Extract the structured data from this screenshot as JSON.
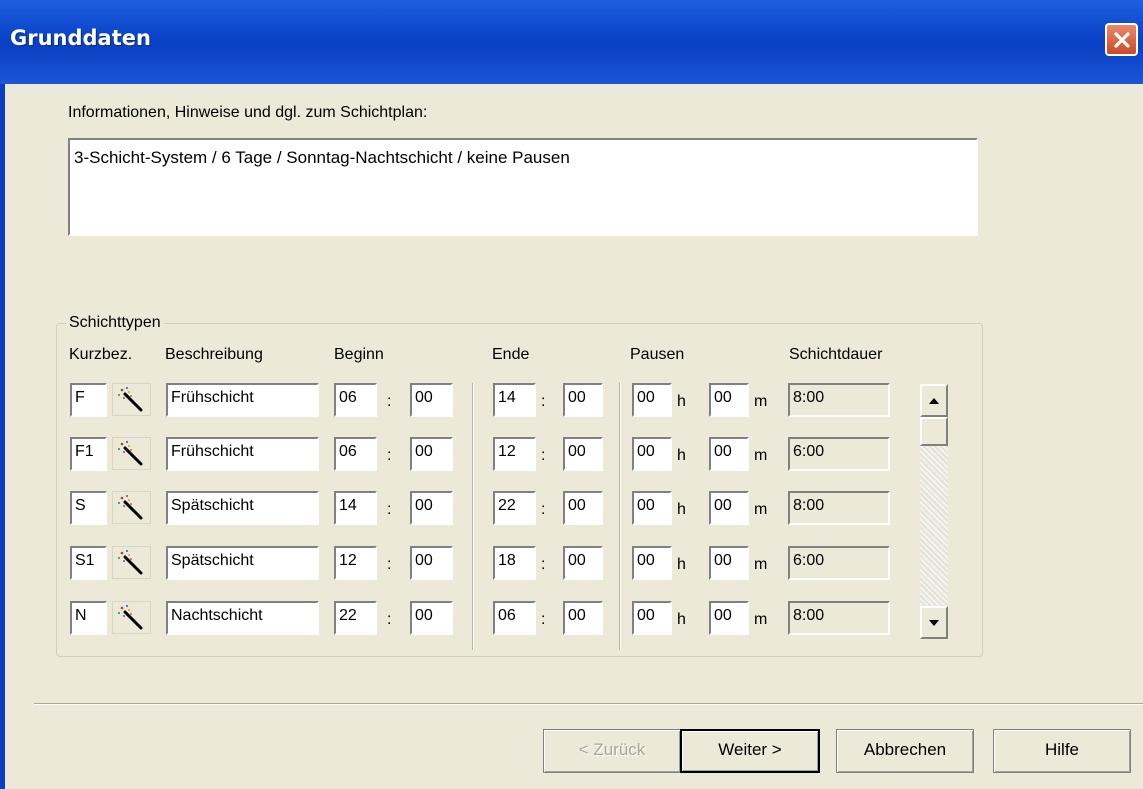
{
  "window": {
    "title": "Grunddaten",
    "close_icon": "close-icon"
  },
  "info": {
    "label": "Informationen, Hinweise und dgl. zum Schichtplan:",
    "value": "3-Schicht-System / 6 Tage / Sonntag-Nachtschicht / keine Pausen"
  },
  "schichttypen": {
    "group_label": "Schichttypen",
    "headers": {
      "kurzbez": "Kurzbez.",
      "beschreibung": "Beschreibung",
      "beginn": "Beginn",
      "ende": "Ende",
      "pausen": "Pausen",
      "schichtdauer": "Schichtdauer"
    },
    "colon": ":",
    "unit_h": "h",
    "unit_m": "m",
    "rows": [
      {
        "kurz": "F",
        "beschreibung": "Frühschicht",
        "beginn_h": "06",
        "beginn_m": "00",
        "ende_h": "14",
        "ende_m": "00",
        "pause_h": "00",
        "pause_m": "00",
        "dauer": "8:00"
      },
      {
        "kurz": "F1",
        "beschreibung": "Frühschicht",
        "beginn_h": "06",
        "beginn_m": "00",
        "ende_h": "12",
        "ende_m": "00",
        "pause_h": "00",
        "pause_m": "00",
        "dauer": "6:00"
      },
      {
        "kurz": "S",
        "beschreibung": "Spätschicht",
        "beginn_h": "14",
        "beginn_m": "00",
        "ende_h": "22",
        "ende_m": "00",
        "pause_h": "00",
        "pause_m": "00",
        "dauer": "8:00"
      },
      {
        "kurz": "S1",
        "beschreibung": "Spätschicht",
        "beginn_h": "12",
        "beginn_m": "00",
        "ende_h": "18",
        "ende_m": "00",
        "pause_h": "00",
        "pause_m": "00",
        "dauer": "6:00"
      },
      {
        "kurz": "N",
        "beschreibung": "Nachtschicht",
        "beginn_h": "22",
        "beginn_m": "00",
        "ende_h": "06",
        "ende_m": "00",
        "pause_h": "00",
        "pause_m": "00",
        "dauer": "8:00"
      }
    ]
  },
  "buttons": {
    "back": "< Zurück",
    "next": "Weiter >",
    "cancel": "Abbrechen",
    "help": "Hilfe"
  }
}
